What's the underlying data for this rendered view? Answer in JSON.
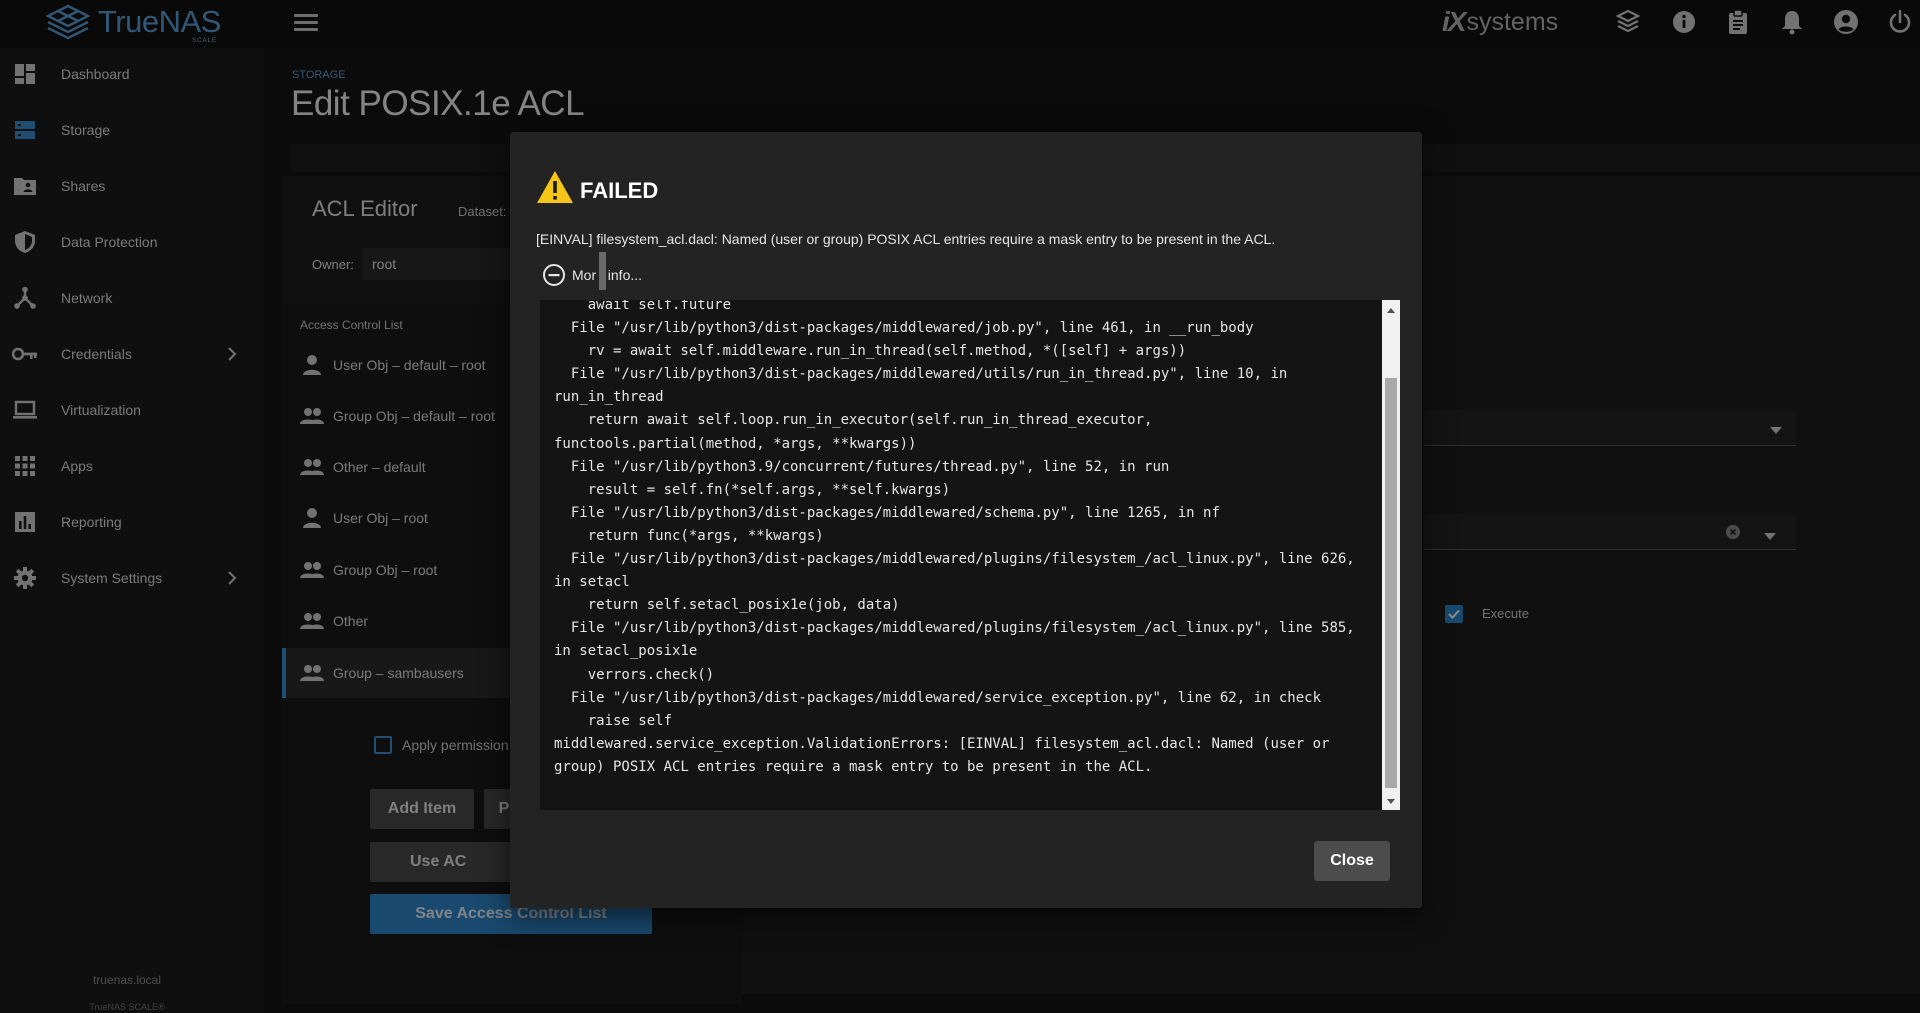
{
  "brand": {
    "name": "TrueNAS",
    "edition": "SCALE",
    "partner": "systems"
  },
  "sidebar": {
    "items": [
      {
        "label": "Dashboard",
        "icon": "dashboard-icon"
      },
      {
        "label": "Storage",
        "icon": "storage-icon"
      },
      {
        "label": "Shares",
        "icon": "folder-shared-icon"
      },
      {
        "label": "Data Protection",
        "icon": "shield-icon"
      },
      {
        "label": "Network",
        "icon": "network-icon"
      },
      {
        "label": "Credentials",
        "icon": "key-icon"
      },
      {
        "label": "Virtualization",
        "icon": "laptop-icon"
      },
      {
        "label": "Apps",
        "icon": "apps-grid-icon"
      },
      {
        "label": "Reporting",
        "icon": "bar-chart-icon"
      },
      {
        "label": "System Settings",
        "icon": "gear-icon"
      }
    ],
    "hostname": "truenas.local",
    "copyright": "TrueNAS SCALE®"
  },
  "page": {
    "breadcrumb": "STORAGE",
    "title": "Edit POSIX.1e ACL"
  },
  "editor": {
    "title": "ACL Editor",
    "dataset_label": "Dataset:",
    "owner_label": "Owner:",
    "owner_value": "root",
    "list_label": "Access Control List",
    "entries": [
      {
        "label": "User Obj – default – root",
        "icon": "person-icon"
      },
      {
        "label": "Group Obj – default – root",
        "icon": "group-icon"
      },
      {
        "label": "Other – default",
        "icon": "group-icon"
      },
      {
        "label": "User Obj – root",
        "icon": "person-icon"
      },
      {
        "label": "Group Obj – root",
        "icon": "group-icon"
      },
      {
        "label": "Other",
        "icon": "group-icon"
      },
      {
        "label": "Group – sambausers",
        "icon": "group-icon"
      }
    ],
    "apply_label": "Apply permission",
    "add_item": "Add Item",
    "second_button": "P",
    "use_acl": "Use AC",
    "save": "Save Access Control List",
    "execute_label": "Execute"
  },
  "dialog": {
    "title": "FAILED",
    "message": "[EINVAL] filesystem_acl.dacl: Named (user or group) POSIX ACL entries require a mask entry to be present in the ACL.",
    "more_info_label": "Mor   info...",
    "trace": "    await self.future\n  File \"/usr/lib/python3/dist-packages/middlewared/job.py\", line 461, in __run_body\n    rv = await self.middleware.run_in_thread(self.method, *([self] + args))\n  File \"/usr/lib/python3/dist-packages/middlewared/utils/run_in_thread.py\", line 10, in\nrun_in_thread\n    return await self.loop.run_in_executor(self.run_in_thread_executor,\nfunctools.partial(method, *args, **kwargs))\n  File \"/usr/lib/python3.9/concurrent/futures/thread.py\", line 52, in run\n    result = self.fn(*self.args, **self.kwargs)\n  File \"/usr/lib/python3/dist-packages/middlewared/schema.py\", line 1265, in nf\n    return func(*args, **kwargs)\n  File \"/usr/lib/python3/dist-packages/middlewared/plugins/filesystem_/acl_linux.py\", line 626,\nin setacl\n    return self.setacl_posix1e(job, data)\n  File \"/usr/lib/python3/dist-packages/middlewared/plugins/filesystem_/acl_linux.py\", line 585,\nin setacl_posix1e\n    verrors.check()\n  File \"/usr/lib/python3/dist-packages/middlewared/service_exception.py\", line 62, in check\n    raise self\nmiddlewared.service_exception.ValidationErrors: [EINVAL] filesystem_acl.dacl: Named (user or\ngroup) POSIX ACL entries require a mask entry to be present in the ACL.",
    "close_label": "Close"
  },
  "colors": {
    "accent": "#3592d5",
    "warning": "#f5c518"
  }
}
